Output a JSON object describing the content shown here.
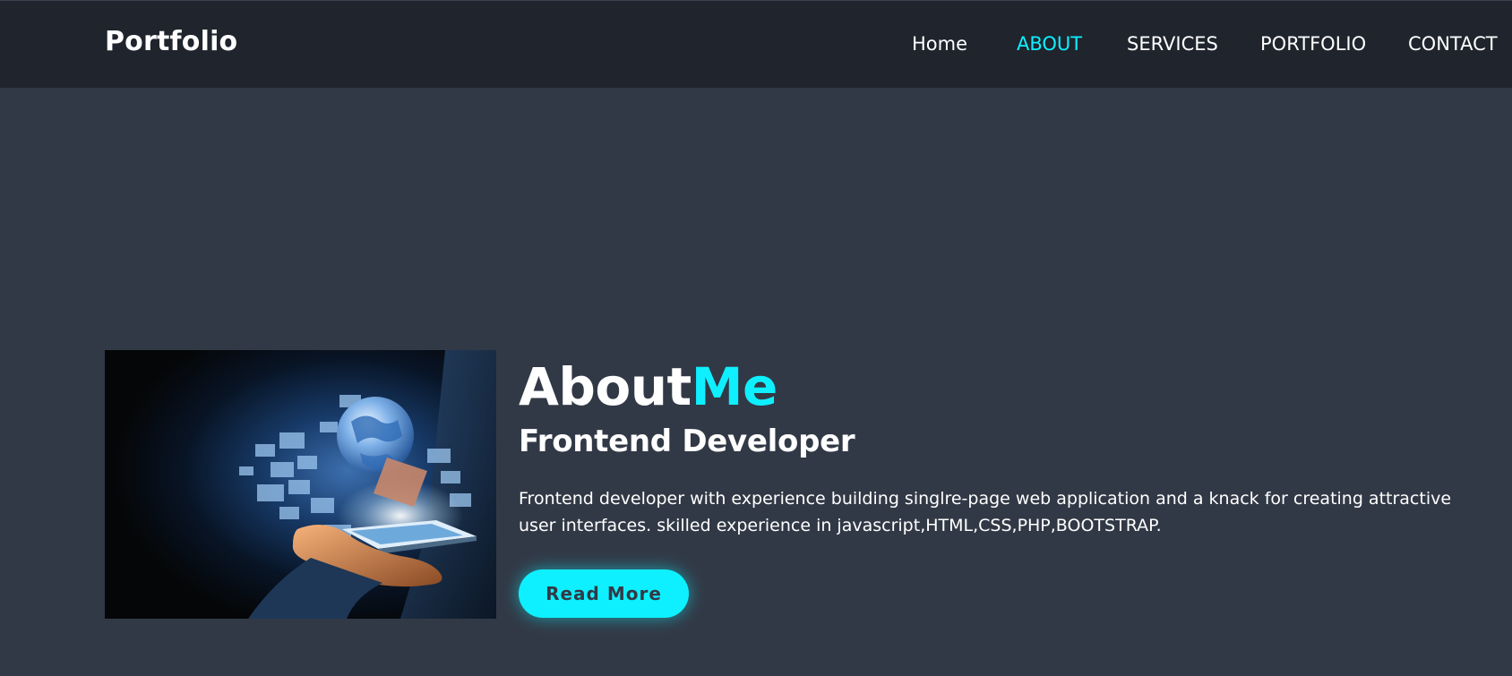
{
  "header": {
    "logo": "Portfolio",
    "nav": [
      {
        "label": "Home",
        "active": false
      },
      {
        "label": "ABOUT",
        "active": true
      },
      {
        "label": "SERVICES",
        "active": false
      },
      {
        "label": "PORTFOLIO",
        "active": false
      },
      {
        "label": "CONTACT",
        "active": false
      }
    ]
  },
  "about": {
    "title_main": "About",
    "title_accent": "Me",
    "subtitle": "Frontend Developer",
    "description": "Frontend developer with experience building singlre-page web application and a knack for creating attractive user interfaces. skilled experience in javascript,HTML,CSS,PHP,BOOTSTRAP.",
    "button_label": "Read More"
  },
  "colors": {
    "background": "#323946",
    "header_bg": "#1f242d",
    "accent": "#0ef0ff",
    "text": "#ffffff"
  }
}
